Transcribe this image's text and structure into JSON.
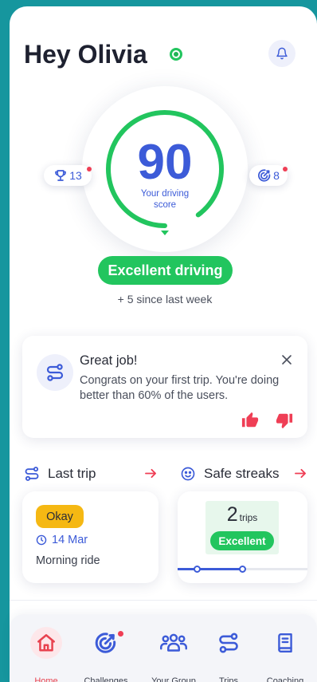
{
  "header": {
    "greeting": "Hey Olivia",
    "status_icon": "online-status-icon",
    "notifications_icon": "bell-icon"
  },
  "score": {
    "value": 90,
    "label": "Your driving score",
    "rating": "Excellent driving",
    "change": "+ 5 since last week"
  },
  "badges": {
    "trophies": {
      "icon": "trophy-icon",
      "count": "13",
      "has_new": true
    },
    "challenges": {
      "icon": "target-icon",
      "count": "8",
      "has_new": true
    }
  },
  "feedback_card": {
    "icon": "route-icon",
    "title": "Great job!",
    "message": "Congrats on your first trip. You're doing better than 60% of the users.",
    "close_icon": "close-icon",
    "actions": [
      "thumbs-up-icon",
      "thumbs-down-icon"
    ]
  },
  "last_trip": {
    "title": "Last trip",
    "icon": "route-icon",
    "status": "Okay",
    "date": "14 Mar",
    "name": "Morning ride"
  },
  "safe_streaks": {
    "title": "Safe streaks",
    "icon": "smiley-icon",
    "count": "2",
    "unit": "trips",
    "rating": "Excellent",
    "progress": 0.5
  },
  "nav": {
    "items": [
      {
        "label": "Home",
        "icon": "home-icon",
        "active": true
      },
      {
        "label": "Challenges",
        "icon": "target-icon",
        "has_badge": true
      },
      {
        "label": "Your Group",
        "icon": "group-icon"
      },
      {
        "label": "Trips",
        "icon": "route-icon"
      },
      {
        "label": "Coaching",
        "icon": "book-icon"
      }
    ]
  },
  "colors": {
    "background": "#16969e",
    "accent_blue": "#3c5bd8",
    "success_green": "#22c55e",
    "alert_red": "#ef3e55",
    "warning_yellow": "#f5b813"
  }
}
